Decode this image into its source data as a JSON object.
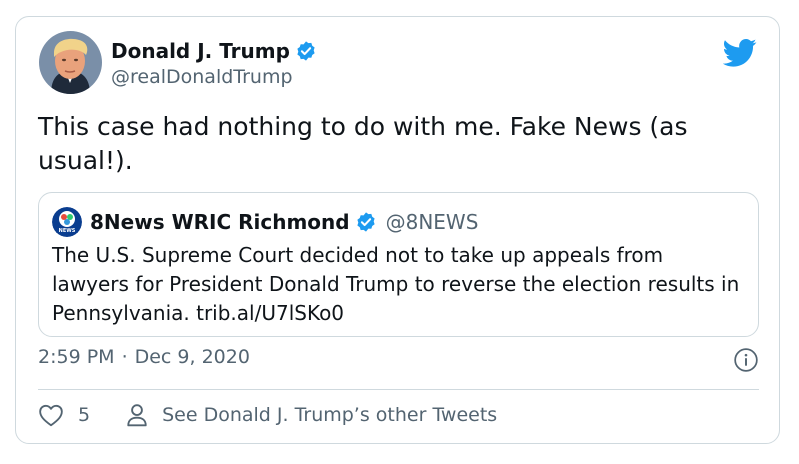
{
  "tweet": {
    "author_name": "Donald J. Trump",
    "author_handle": "@realDonaldTrump",
    "text": "This case had nothing to do with me. Fake News (as usual!).",
    "timestamp_time": "2:59 PM",
    "timestamp_separator": "·",
    "timestamp_date": "Dec 9, 2020",
    "like_count": "5",
    "other_tweets_label": "See Donald J. Trump’s other Tweets"
  },
  "quoted": {
    "author_name": "8News WRIC Richmond",
    "author_handle": "@8NEWS",
    "text": "The U.S. Supreme Court decided not to take up appeals from lawyers for President Donald Trump to reverse the election results in Pennsylvania. trib.al/U7lSKo0",
    "logo_text": "NEWS"
  },
  "icons": {
    "brand": "twitter-bird-icon",
    "verified": "verified-badge-icon",
    "info": "info-icon",
    "like": "heart-icon",
    "profile": "person-icon"
  },
  "colors": {
    "twitter_blue": "#1d9bf0",
    "text_primary": "#0f1419",
    "text_secondary": "#536471",
    "border": "#cfd9de"
  }
}
